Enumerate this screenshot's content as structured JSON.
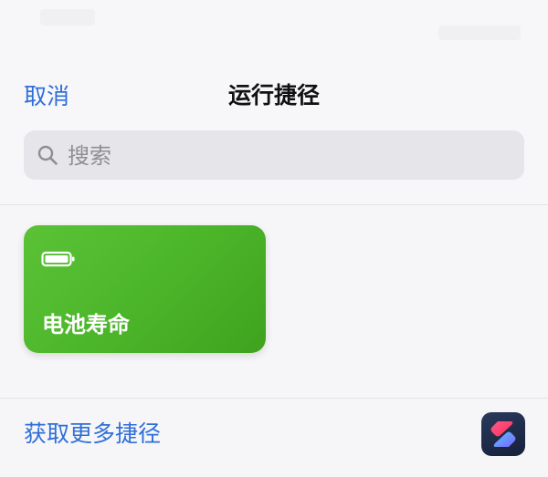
{
  "header": {
    "cancel_label": "取消",
    "title": "运行捷径"
  },
  "search": {
    "placeholder": "搜索",
    "icon": "search-icon"
  },
  "shortcuts": [
    {
      "label": "电池寿命",
      "icon": "battery-icon",
      "color": "#4cb62a"
    }
  ],
  "footer": {
    "get_more_label": "获取更多捷径",
    "app_icon": "shortcuts-app-icon"
  },
  "colors": {
    "accent": "#2f6fd8",
    "card_green": "#4cb62a",
    "background": "#f6f6f8"
  }
}
